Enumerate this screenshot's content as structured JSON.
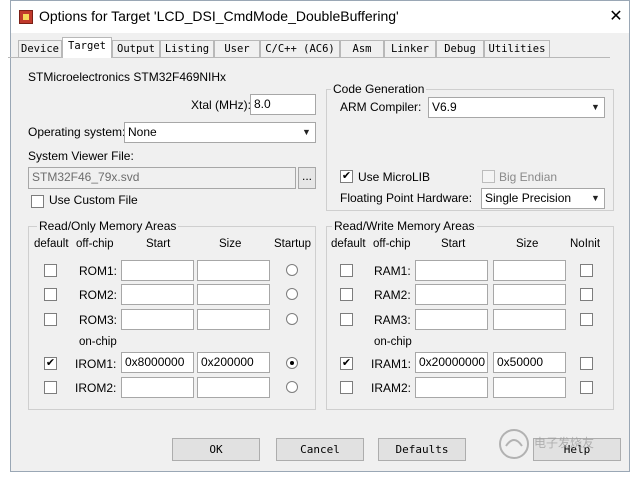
{
  "window": {
    "title": "Options for Target 'LCD_DSI_CmdMode_DoubleBuffering'",
    "close": "✕"
  },
  "tabs": [
    "Device",
    "Target",
    "Output",
    "Listing",
    "User",
    "C/C++ (AC6)",
    "Asm",
    "Linker",
    "Debug",
    "Utilities"
  ],
  "active_tab": "Target",
  "device": {
    "name": "STMicroelectronics STM32F469NIHx",
    "xtal_label": "Xtal (MHz):",
    "xtal_value": "8.0",
    "os_label": "Operating system:",
    "os_value": "None",
    "sysviewer_label": "System Viewer File:",
    "sysviewer_value": "STM32F46_79x.svd",
    "browse": "...",
    "use_custom_file": "Use Custom File",
    "use_custom_checked": false
  },
  "code_generation": {
    "title": "Code Generation",
    "compiler_label": "ARM Compiler:",
    "compiler_value": "V6.9",
    "microlib_label": "Use MicroLIB",
    "microlib_checked": true,
    "big_endian_label": "Big Endian",
    "big_endian_checked": false,
    "fpu_label": "Floating Point Hardware:",
    "fpu_value": "Single Precision"
  },
  "rom_area": {
    "title": "Read/Only Memory Areas",
    "headers": [
      "default",
      "off-chip",
      "Start",
      "Size",
      "Startup"
    ],
    "onchip_label": "on-chip",
    "rows": [
      {
        "name": "ROM1:",
        "start": "",
        "size": "",
        "default": false,
        "startup": false
      },
      {
        "name": "ROM2:",
        "start": "",
        "size": "",
        "default": false,
        "startup": false
      },
      {
        "name": "ROM3:",
        "start": "",
        "size": "",
        "default": false,
        "startup": false
      },
      {
        "name": "IROM1:",
        "start": "0x8000000",
        "size": "0x200000",
        "default": true,
        "startup": true
      },
      {
        "name": "IROM2:",
        "start": "",
        "size": "",
        "default": false,
        "startup": false
      }
    ]
  },
  "ram_area": {
    "title": "Read/Write Memory Areas",
    "headers": [
      "default",
      "off-chip",
      "Start",
      "Size",
      "NoInit"
    ],
    "onchip_label": "on-chip",
    "rows": [
      {
        "name": "RAM1:",
        "start": "",
        "size": "",
        "default": false,
        "noinit": false
      },
      {
        "name": "RAM2:",
        "start": "",
        "size": "",
        "default": false,
        "noinit": false
      },
      {
        "name": "RAM3:",
        "start": "",
        "size": "",
        "default": false,
        "noinit": false
      },
      {
        "name": "IRAM1:",
        "start": "0x20000000",
        "size": "0x50000",
        "default": true,
        "noinit": false
      },
      {
        "name": "IRAM2:",
        "start": "",
        "size": "",
        "default": false,
        "noinit": false
      }
    ]
  },
  "buttons": {
    "ok": "OK",
    "cancel": "Cancel",
    "defaults": "Defaults",
    "help": "Help"
  },
  "watermark": {
    "text": "电子发烧友"
  },
  "colors": {
    "window_bg": "#f0f0f0",
    "field_bg": "#ffffff",
    "border": "#a7a7a7"
  }
}
